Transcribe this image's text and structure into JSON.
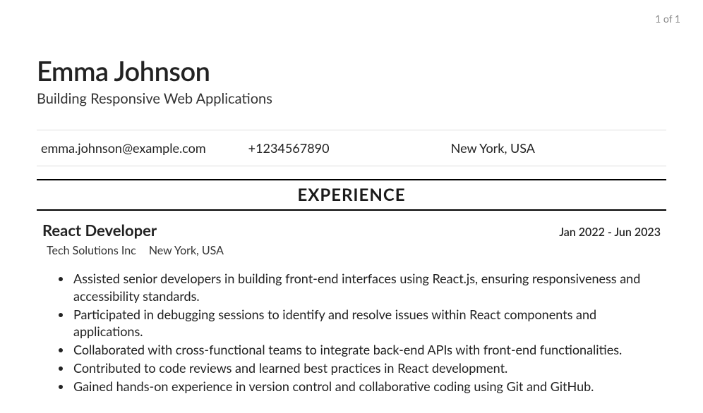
{
  "page_indicator": "1 of 1",
  "header": {
    "name": "Emma Johnson",
    "tagline": "Building Responsive Web Applications"
  },
  "contact": {
    "email": "emma.johnson@example.com",
    "phone": "+1234567890",
    "location": "New York, USA"
  },
  "sections": {
    "experience_heading": "EXPERIENCE"
  },
  "experience": [
    {
      "title": "React Developer",
      "dates": "Jan 2022 - Jun 2023",
      "company": "Tech Solutions Inc",
      "location": "New York, USA",
      "bullets": [
        "Assisted senior developers in building front-end interfaces using React.js, ensuring responsiveness and accessibility standards.",
        "Participated in debugging sessions to identify and resolve issues within React components and applications.",
        "Collaborated with cross-functional teams to integrate back-end APIs with front-end functionalities.",
        "Contributed to code reviews and learned best practices in React development.",
        "Gained hands-on experience in version control and collaborative coding using Git and GitHub."
      ]
    }
  ]
}
